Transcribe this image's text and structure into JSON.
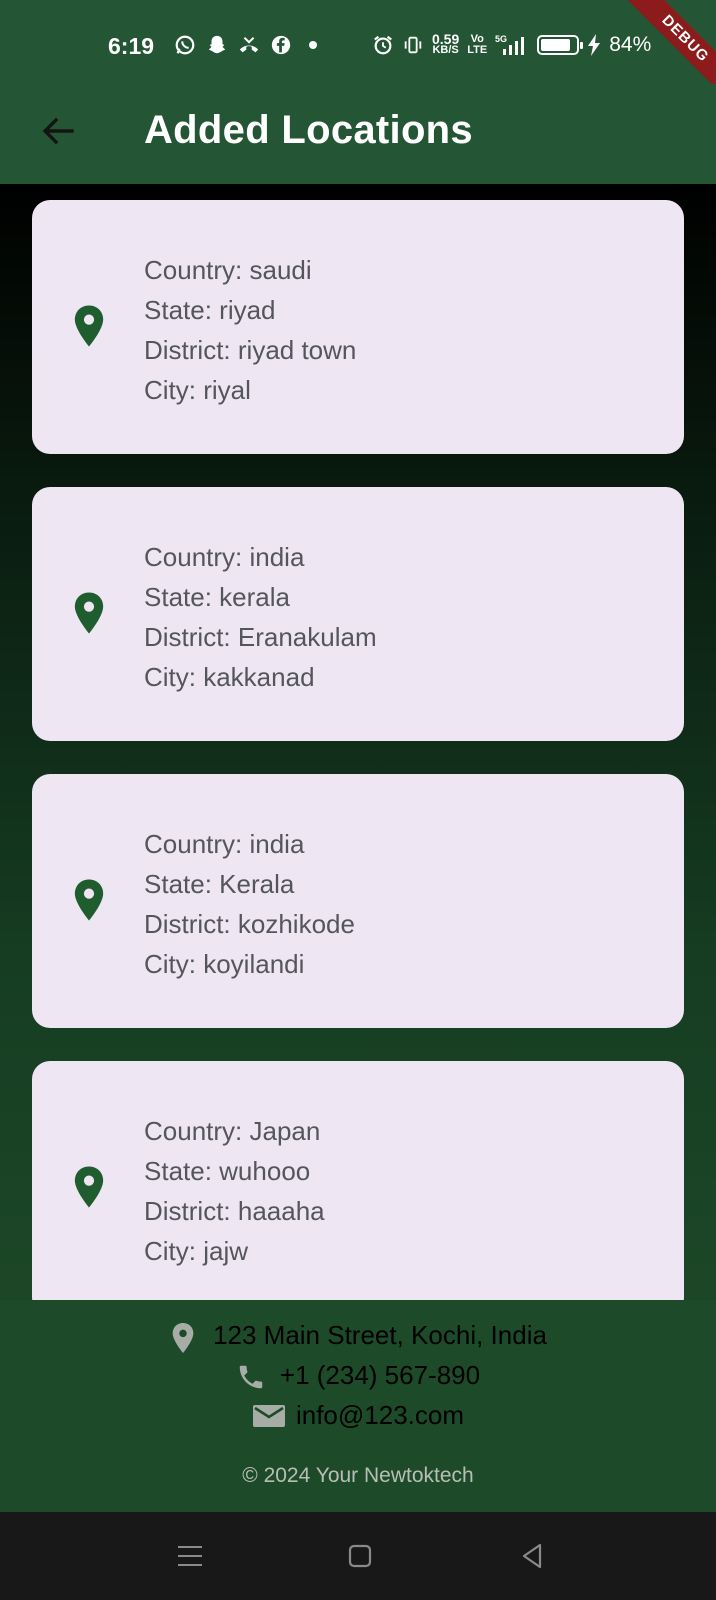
{
  "status_bar": {
    "time": "6:19",
    "net_speed": "0.59",
    "net_unit": "KB/S",
    "volte": "Vo",
    "lte": "LTE",
    "signal": "5G",
    "battery_percent": "84%",
    "battery_level": 0.84
  },
  "debug_banner": "DEBUG",
  "app_bar": {
    "title": "Added Locations",
    "back_icon": "arrow-back-icon"
  },
  "locations": [
    {
      "country": "Country: saudi",
      "state": "State: riyad",
      "district": "District: riyad town",
      "city": "City: riyal"
    },
    {
      "country": "Country: india",
      "state": "State: kerala",
      "district": "District: Eranakulam",
      "city": "City: kakkanad"
    },
    {
      "country": "Country: india",
      "state": "State: Kerala",
      "district": "District: kozhikode",
      "city": "City: koyilandi"
    },
    {
      "country": "Country: Japan",
      "state": "State: wuhooo",
      "district": "District: haaaha",
      "city": "City: jajw"
    }
  ],
  "footer": {
    "address": "123 Main Street, Kochi, India",
    "phone": "+1 (234) 567-890",
    "email": "info@123.com",
    "copyright": "© 2024 Your Newtoktech"
  },
  "colors": {
    "primary": "#245635",
    "card": "#eee7f3",
    "icon": "#1f5c2e",
    "text": "#55565c"
  }
}
